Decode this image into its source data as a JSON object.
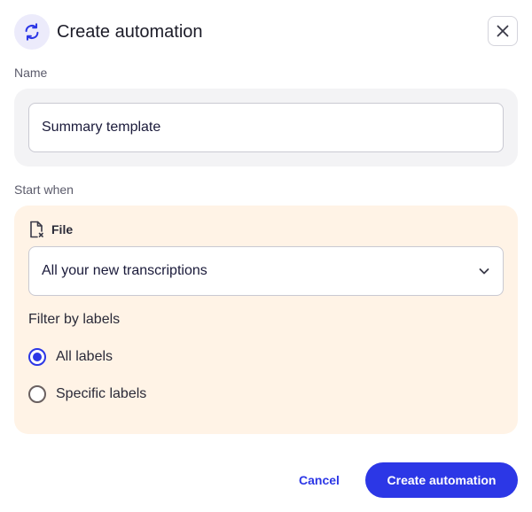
{
  "dialog": {
    "title": "Create automation",
    "icon": "sync-icon",
    "close_icon": "close-icon"
  },
  "name_section": {
    "label": "Name",
    "value": "Summary template"
  },
  "start_section": {
    "label": "Start when",
    "source_icon": "file-icon",
    "source_label": "File",
    "select_value": "All your new transcriptions",
    "select_icon": "chevron-down-icon",
    "filter_label": "Filter by labels",
    "options": [
      {
        "label": "All labels",
        "checked": true
      },
      {
        "label": "Specific labels",
        "checked": false
      }
    ]
  },
  "footer": {
    "cancel_label": "Cancel",
    "create_label": "Create automation"
  },
  "colors": {
    "accent": "#2c37e6",
    "panel_gray": "#f3f3f5",
    "panel_peach": "#fff3e6"
  }
}
